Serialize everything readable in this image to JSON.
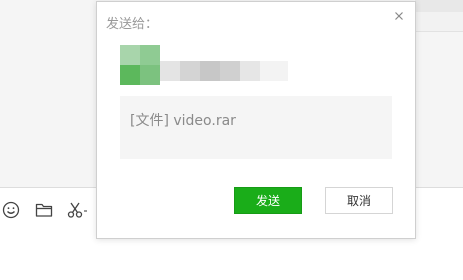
{
  "dialog": {
    "title": "发送给：",
    "recipient": {
      "name_pixelated": true
    },
    "message": "[文件] video.rar",
    "send_label": "发送",
    "cancel_label": "取消"
  },
  "colors": {
    "send_button": "#1aad19",
    "avatar_green": "#5cb85c",
    "message_bg": "#f5f5f5"
  },
  "toolbar": {
    "icons": [
      "emoji-icon",
      "folder-icon",
      "scissors-icon"
    ]
  }
}
